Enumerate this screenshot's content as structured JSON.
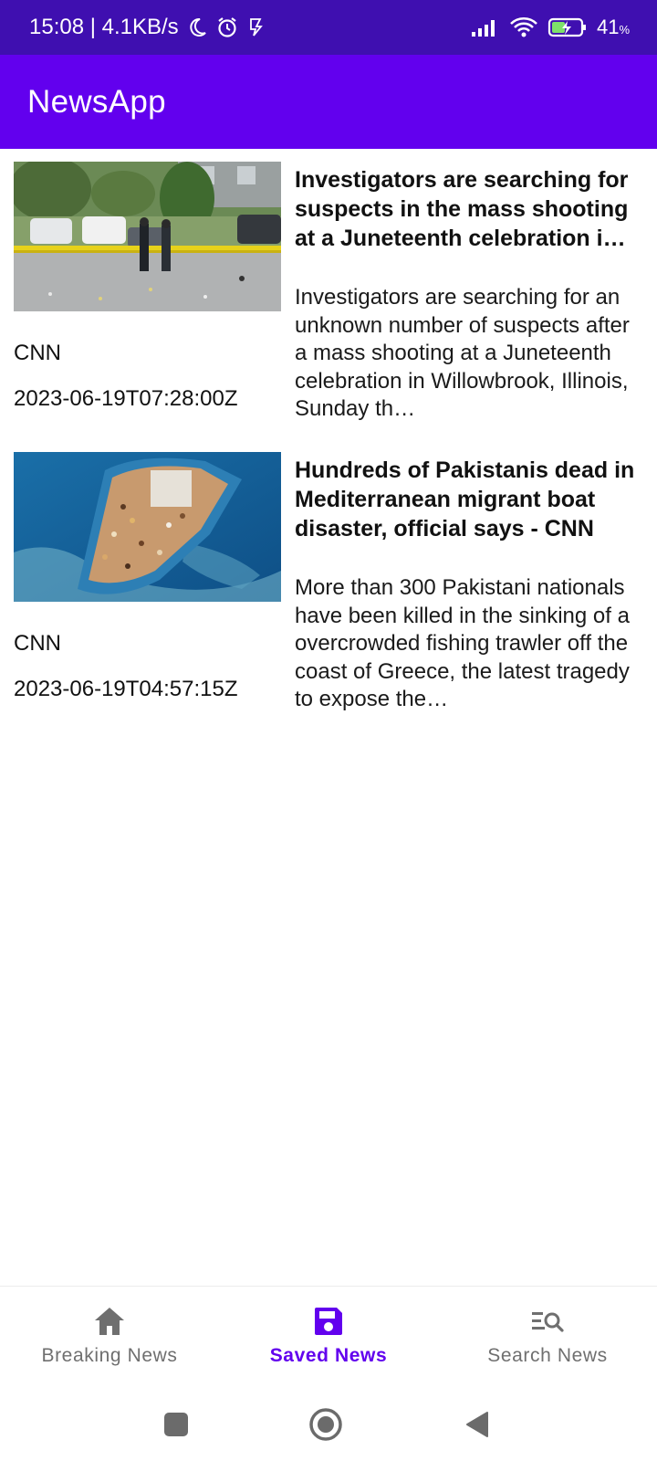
{
  "status_bar": {
    "time_speed": "15:08 | 4.1KB/s",
    "battery_percent": "41",
    "battery_unit": "%",
    "icons": [
      "moon-icon",
      "alarm-icon",
      "sim-icon",
      "signal-icon",
      "wifi-icon",
      "battery-charging-icon"
    ]
  },
  "app_bar": {
    "title": "NewsApp"
  },
  "articles": [
    {
      "title": "Investigators are searching for suspects in the mass shooting at a Juneteenth celebration i…",
      "description": "Investigators are searching for an unknown number of suspects after a mass shooting at a Juneteenth celebration in Willowbrook, Illinois, Sunday th…",
      "source": "CNN",
      "published_at": "2023-06-19T07:28:00Z"
    },
    {
      "title": "Hundreds of Pakistanis dead in Mediterranean migrant boat disaster, official says - CNN",
      "description": "More than 300 Pakistani nationals have been killed in the sinking of a overcrowded fishing trawler off the coast of Greece, the latest tragedy to expose the…",
      "source": "CNN",
      "published_at": "2023-06-19T04:57:15Z"
    }
  ],
  "bottom_nav": {
    "items": [
      {
        "label": "Breaking News",
        "icon": "home-icon"
      },
      {
        "label": "Saved News",
        "icon": "save-icon"
      },
      {
        "label": "Search News",
        "icon": "search-list-icon"
      }
    ],
    "active_index": 1
  },
  "colors": {
    "status_bar": "#3f0fb0",
    "primary": "#6200ee",
    "inactive": "#6f6f6f"
  }
}
